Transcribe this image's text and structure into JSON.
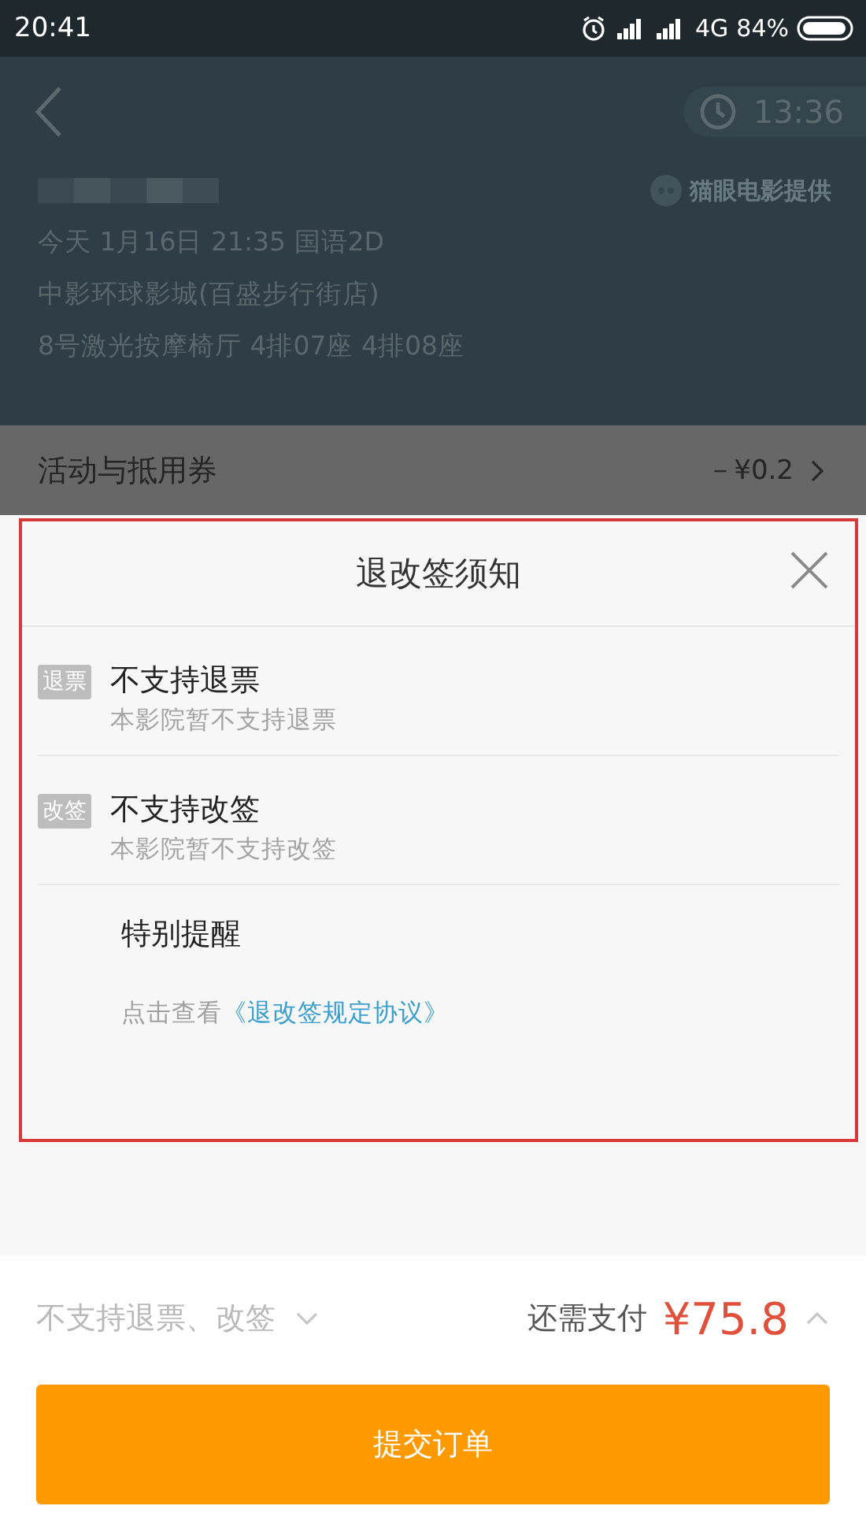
{
  "status_bar": {
    "time": "20:41",
    "network": "4G",
    "battery": "84%"
  },
  "header": {
    "timer": "13:36",
    "provider": "猫眼电影提供",
    "show_time": "今天 1月16日 21:35 国语2D",
    "cinema": "中影环球影城(百盛步行街店)",
    "seats": "8号激光按摩椅厅 4排07座 4排08座"
  },
  "discount_row": {
    "label": "活动与抵用券",
    "value": "－¥0.2"
  },
  "notice": {
    "title": "退改签须知",
    "items": [
      {
        "tag": "退票",
        "title": "不支持退票",
        "subtitle": "本影院暂不支持退票"
      },
      {
        "tag": "改签",
        "title": "不支持改签",
        "subtitle": "本影院暂不支持改签"
      }
    ],
    "reminder": "特别提醒",
    "agreement": {
      "prefix": "点击查看",
      "link": "《退改签规定协议》"
    }
  },
  "footer": {
    "policy": "不支持退票、改签",
    "due_label": "还需支付",
    "due_amount": "¥75.8",
    "submit": "提交订单"
  }
}
